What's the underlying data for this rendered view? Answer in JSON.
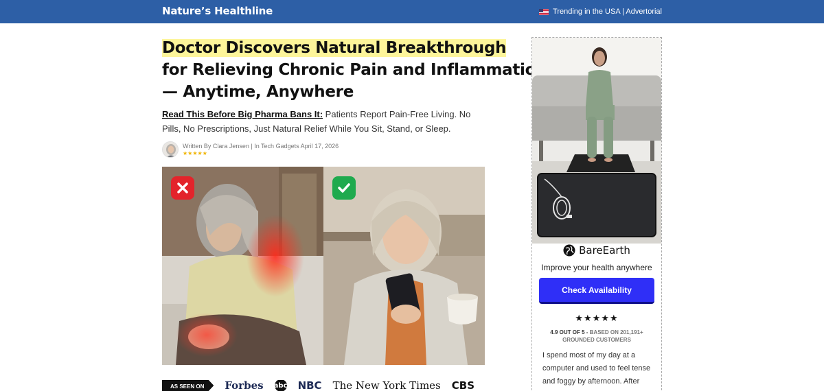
{
  "header": {
    "brand": "Nature’s Healthline",
    "trending": "Trending in the USA | Advertorial"
  },
  "article": {
    "headline_line1": "Doctor Discovers Natural Breakthrough",
    "headline_line2": "for Relieving Chronic Pain and Inflammation",
    "headline_line3": "— Anytime, Anywhere",
    "subhead_lead": "Read This Before Big Pharma Bans It:",
    "subhead_text": " Patients Report Pain-Free Living. No Pills, No Prescriptions, Just Natural Relief While You Sit, Stand, or Sleep.",
    "byline": "Written By Clara Jensen | In Tech Gadgets April 17, 2026",
    "byline_stars": "★★★★★"
  },
  "as_seen_on": {
    "label": "AS SEEN ON",
    "logos": [
      "Forbes",
      "abc",
      "NBC",
      "The New York Times",
      "CBS"
    ]
  },
  "ad": {
    "brand": "BareEarth",
    "tagline": "Improve your health anywhere",
    "cta": "Check Availability",
    "stars": "★★★★★",
    "rating_score": "4.9 OUT OF 5 -",
    "rating_text": " BASED ON 201,191+ GROUNDED CUSTOMERS",
    "review": "I spend most of my day at a computer and used to feel tense and foggy by afternoon. After"
  },
  "colors": {
    "header_bg": "#2d5fa6",
    "highlight": "#fdf59a",
    "cta_bg": "#2f2ff7",
    "bad_badge": "#e3242b",
    "good_badge": "#1faa4e",
    "star_gold": "#f0b400"
  }
}
